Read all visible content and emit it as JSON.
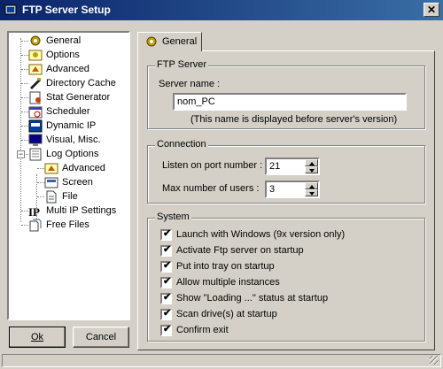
{
  "window": {
    "title": "FTP Server Setup",
    "close_label": "✕"
  },
  "tree": {
    "items": [
      {
        "label": "General",
        "icon": "gear-icon",
        "color": "#c0a000"
      },
      {
        "label": "Options",
        "icon": "options-icon",
        "color": "#c0a000"
      },
      {
        "label": "Advanced",
        "icon": "advanced-icon",
        "color": "#c0a000"
      },
      {
        "label": "Directory Cache",
        "icon": "cache-icon",
        "color": "#202020"
      },
      {
        "label": "Stat Generator",
        "icon": "stats-icon",
        "color": "#c04000"
      },
      {
        "label": "Scheduler",
        "icon": "scheduler-icon",
        "color": "#4040a0"
      },
      {
        "label": "Dynamic IP",
        "icon": "dynamic-ip-icon",
        "color": "#0040a0"
      },
      {
        "label": "Visual, Misc.",
        "icon": "monitor-icon",
        "color": "#000080"
      },
      {
        "label": "Log Options",
        "icon": "log-icon",
        "color": "#808080"
      },
      {
        "label": "Advanced",
        "icon": "advanced-icon",
        "color": "#c0a000"
      },
      {
        "label": "Screen",
        "icon": "screen-icon",
        "color": "#4060a0"
      },
      {
        "label": "File",
        "icon": "file-icon",
        "color": "#406080"
      },
      {
        "label": "Multi IP Settings",
        "icon": "ip-icon",
        "color": "#000000"
      },
      {
        "label": "Free Files",
        "icon": "files-icon",
        "color": "#406080"
      }
    ],
    "log_options_expander": "−"
  },
  "buttons": {
    "ok": "Ok",
    "cancel": "Cancel"
  },
  "tab": {
    "label": "General"
  },
  "ftp_server": {
    "title": "FTP Server",
    "server_name_label": "Server name :",
    "server_name_value": "nom_PC",
    "hint": "(This name is displayed before server's version)"
  },
  "connection": {
    "title": "Connection",
    "port_label": "Listen on port number :",
    "port_value": "21",
    "max_users_label": "Max number of users :",
    "max_users_value": "3"
  },
  "system": {
    "title": "System",
    "options": [
      {
        "label": "Launch with Windows (9x version only)",
        "checked": true
      },
      {
        "label": "Activate Ftp server on startup",
        "checked": true
      },
      {
        "label": "Put into tray on startup",
        "checked": true
      },
      {
        "label": "Allow multiple instances",
        "checked": true
      },
      {
        "label": "Show \"Loading ...\" status at startup",
        "checked": true
      },
      {
        "label": "Scan drive(s) at startup",
        "checked": true
      },
      {
        "label": "Confirm exit",
        "checked": true
      }
    ],
    "check_glyph": "✔"
  }
}
